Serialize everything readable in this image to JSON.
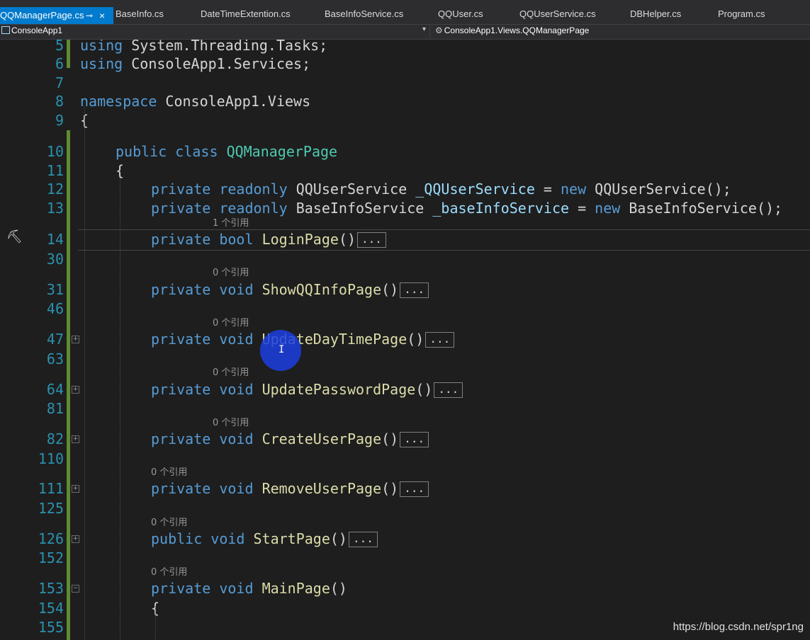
{
  "tabs": [
    {
      "label": "QQManagerPage.cs",
      "active": true
    },
    {
      "label": "BaseInfo.cs"
    },
    {
      "label": "DateTimeExtention.cs"
    },
    {
      "label": "BaseInfoService.cs"
    },
    {
      "label": "QQUser.cs"
    },
    {
      "label": "QQUserService.cs"
    },
    {
      "label": "DBHelper.cs"
    },
    {
      "label": "Program.cs"
    }
  ],
  "tab_pin_icon": "pin-icon",
  "tab_close_glyph": "×",
  "nav": {
    "project": "ConsoleApp1",
    "member": "ConsoleApp1.Views.QQManagerPage",
    "dropdown_glyph": "▾"
  },
  "editor": {
    "lines": [
      {
        "n": "5",
        "t": [
          [
            "using",
            "kw"
          ],
          [
            " System.Threading.Tasks;",
            "nm"
          ]
        ]
      },
      {
        "n": "6",
        "t": [
          [
            "using",
            "kw"
          ],
          [
            " ConsoleApp1.Services;",
            "nm"
          ]
        ]
      },
      {
        "n": "7",
        "t": []
      },
      {
        "n": "8",
        "t": [
          [
            "namespace",
            "kw"
          ],
          [
            " ConsoleApp1.Views",
            "nm"
          ]
        ]
      },
      {
        "n": "9",
        "t": [
          [
            "{",
            "nm"
          ]
        ]
      },
      {
        "n": "10",
        "t": [
          [
            "public",
            "kw"
          ],
          [
            " ",
            "nm"
          ],
          [
            "class",
            "kw"
          ],
          [
            " ",
            "nm"
          ],
          [
            "QQManagerPage",
            "ty"
          ]
        ]
      },
      {
        "n": "11",
        "t": [
          [
            "{",
            "nm"
          ]
        ]
      },
      {
        "n": "12",
        "t": [
          [
            "private",
            "kw"
          ],
          [
            " ",
            "nm"
          ],
          [
            "readonly",
            "kw"
          ],
          [
            " QQUserService ",
            "nm"
          ],
          [
            "_QQUserService",
            "fld"
          ],
          [
            " = ",
            "nm"
          ],
          [
            "new",
            "kw"
          ],
          [
            " QQUserService();",
            "nm"
          ]
        ]
      },
      {
        "n": "13",
        "t": [
          [
            "private",
            "kw"
          ],
          [
            " ",
            "nm"
          ],
          [
            "readonly",
            "kw"
          ],
          [
            " BaseInfoService ",
            "nm"
          ],
          [
            "_baseInfoService",
            "fld"
          ],
          [
            " = ",
            "nm"
          ],
          [
            "new",
            "kw"
          ],
          [
            " BaseInfoService();",
            "nm"
          ]
        ]
      },
      {
        "n": "14",
        "t": [
          [
            "private",
            "kw"
          ],
          [
            " ",
            "nm"
          ],
          [
            "bool",
            "kw"
          ],
          [
            " ",
            "nm"
          ],
          [
            "LoginPage",
            "fn"
          ],
          [
            "()",
            "nm"
          ]
        ],
        "collapsed": "..."
      },
      {
        "n": "30",
        "t": []
      },
      {
        "n": "31",
        "t": [
          [
            "private",
            "kw"
          ],
          [
            " ",
            "nm"
          ],
          [
            "void",
            "kw"
          ],
          [
            " ",
            "nm"
          ],
          [
            "ShowQQInfoPage",
            "fn"
          ],
          [
            "()",
            "nm"
          ]
        ],
        "collapsed": "..."
      },
      {
        "n": "46",
        "t": []
      },
      {
        "n": "47",
        "t": [
          [
            "private",
            "kw"
          ],
          [
            " ",
            "nm"
          ],
          [
            "void",
            "kw"
          ],
          [
            " ",
            "nm"
          ],
          [
            "UpdateDayTimePage",
            "fn"
          ],
          [
            "()",
            "nm"
          ]
        ],
        "collapsed": "..."
      },
      {
        "n": "63",
        "t": []
      },
      {
        "n": "64",
        "t": [
          [
            "private",
            "kw"
          ],
          [
            " ",
            "nm"
          ],
          [
            "void",
            "kw"
          ],
          [
            " ",
            "nm"
          ],
          [
            "UpdatePasswordPage",
            "fn"
          ],
          [
            "()",
            "nm"
          ]
        ],
        "collapsed": "..."
      },
      {
        "n": "81",
        "t": []
      },
      {
        "n": "82",
        "t": [
          [
            "private",
            "kw"
          ],
          [
            " ",
            "nm"
          ],
          [
            "void",
            "kw"
          ],
          [
            " ",
            "nm"
          ],
          [
            "CreateUserPage",
            "fn"
          ],
          [
            "()",
            "nm"
          ]
        ],
        "collapsed": "..."
      },
      {
        "n": "110",
        "t": []
      },
      {
        "n": "111",
        "t": [
          [
            "private",
            "kw"
          ],
          [
            " ",
            "nm"
          ],
          [
            "void",
            "kw"
          ],
          [
            " ",
            "nm"
          ],
          [
            "RemoveUserPage",
            "fn"
          ],
          [
            "()",
            "nm"
          ]
        ],
        "collapsed": "..."
      },
      {
        "n": "125",
        "t": []
      },
      {
        "n": "126",
        "t": [
          [
            "public",
            "kw"
          ],
          [
            " ",
            "nm"
          ],
          [
            "void",
            "kw"
          ],
          [
            " ",
            "nm"
          ],
          [
            "StartPage",
            "fn"
          ],
          [
            "()",
            "nm"
          ]
        ],
        "collapsed": "..."
      },
      {
        "n": "152",
        "t": []
      },
      {
        "n": "153",
        "t": [
          [
            "private",
            "kw"
          ],
          [
            " ",
            "nm"
          ],
          [
            "void",
            "kw"
          ],
          [
            " ",
            "nm"
          ],
          [
            "MainPage",
            "fn"
          ],
          [
            "()",
            "nm"
          ]
        ]
      },
      {
        "n": "154",
        "t": [
          [
            "{",
            "nm"
          ]
        ]
      },
      {
        "n": "155",
        "t": []
      }
    ],
    "hints": [
      "1 个引用",
      "0 个引用",
      "0 个引用",
      "0 个引用",
      "0 个引用",
      "0 个引用",
      "0 个引用",
      "0 个引用"
    ],
    "fold_glyph_collapsed": "+",
    "fold_glyph_expanded": "−"
  },
  "icons": {
    "hammer": "hammer-icon",
    "cursor": "ibeam-cursor-icon"
  },
  "cursor_glyph": "I",
  "hammer_glyph": "⛏",
  "watermark": "https://blog.csdn.net/spr1ng"
}
